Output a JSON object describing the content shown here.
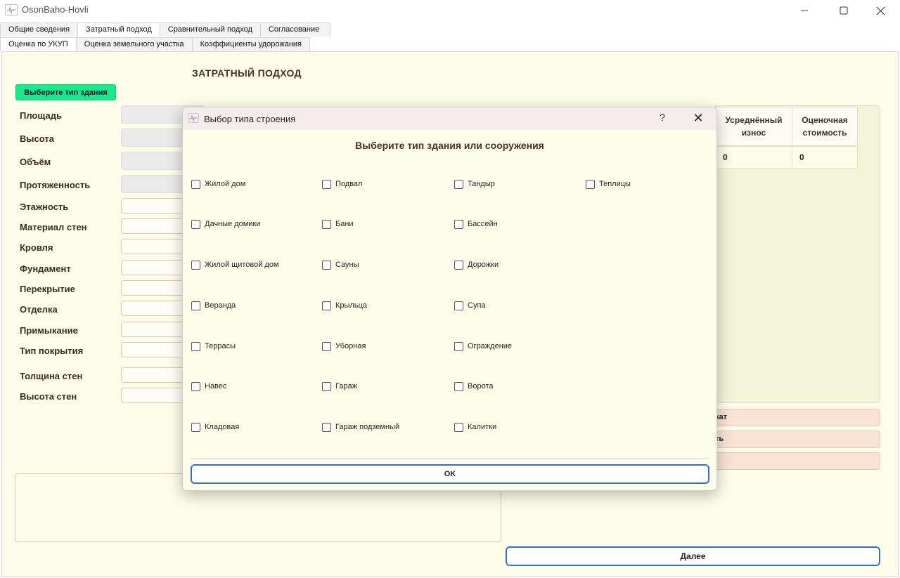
{
  "window": {
    "title": "OsonBaho-Hovli",
    "minimize_icon": "minimize-icon",
    "maximize_icon": "maximize-icon",
    "close_icon": "close-icon"
  },
  "tabs_top": [
    {
      "label": "Общие сведения",
      "active": false
    },
    {
      "label": "Затратный подход",
      "active": true
    },
    {
      "label": "Сравнительный подход",
      "active": false
    },
    {
      "label": "Согласование",
      "active": false
    }
  ],
  "tabs_sub": [
    {
      "label": "Оценка по УКУП",
      "active": true
    },
    {
      "label": "Оценка земельного участка",
      "active": false
    },
    {
      "label": "Коэффициенты удорожания",
      "active": false
    }
  ],
  "main": {
    "section_title": "ЗАТРАТНЫЙ ПОДХОД",
    "select_type_button": "Выберите тип здания",
    "fields": [
      {
        "label": "Площадь",
        "value": ""
      },
      {
        "label": "Высота",
        "value": ""
      },
      {
        "label": "Объём",
        "value": ""
      },
      {
        "label": "Протяженность",
        "value": ""
      },
      {
        "label": "Этажность",
        "value": ""
      },
      {
        "label": "Материал стен",
        "value": ""
      },
      {
        "label": "Кровля",
        "value": ""
      },
      {
        "label": "Фундамент",
        "value": ""
      },
      {
        "label": "Перекрытие",
        "value": ""
      },
      {
        "label": "Отделка",
        "value": ""
      },
      {
        "label": "Примыкание",
        "value": ""
      },
      {
        "label": "Тип покрытия",
        "value": ""
      },
      {
        "label": "Толщина стен",
        "value": ""
      },
      {
        "label": "Высота стен",
        "value": ""
      }
    ],
    "notes_value": "",
    "table": {
      "headers": [
        "Усреднённый износ",
        "Оценочная стоимость"
      ],
      "row": [
        "0",
        "0"
      ]
    },
    "side_buttons": [
      "кат",
      "ть",
      ""
    ],
    "next_button": "Далее",
    "accent_color": "#18e98a",
    "focus_color": "#2f6fd6"
  },
  "dialog": {
    "title": "Выбор типа строения",
    "help_label": "?",
    "close_label": "✕",
    "heading": "Выберите тип здания или сооружения",
    "columns": [
      [
        "Жилой дом",
        "Дачные домики",
        "Жилой щитовой дом",
        "Веранда",
        "Террасы",
        "Навес",
        "Кладовая"
      ],
      [
        "Подвал",
        "Бани",
        "Сауны",
        "Крыльца",
        "Уборная",
        "Гараж",
        "Гараж подземный"
      ],
      [
        "Тандыр",
        "Бассейн",
        "Дорожки",
        "Супа",
        "Ограждение",
        "Ворота",
        "Калитки"
      ],
      [
        "Теплицы"
      ]
    ],
    "ok_button": "OK"
  }
}
